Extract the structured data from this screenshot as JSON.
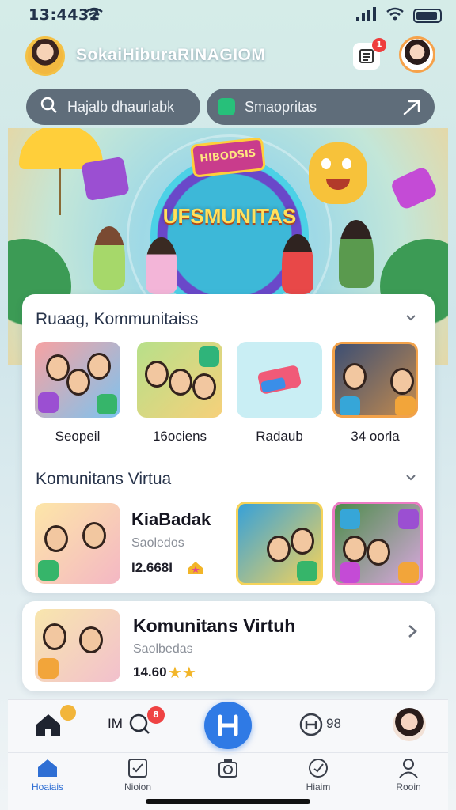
{
  "status_bar": {
    "time": "13:4432"
  },
  "header": {
    "app_title": "SokaiHiburaRINAGIOM",
    "notification_count": "1"
  },
  "search": {
    "left_placeholder": "Hajalb dhaurlabk",
    "right_placeholder": "Smaopritas"
  },
  "hero": {
    "title": "UFSMUNITAS",
    "sign": "HIBODSIS"
  },
  "sections": [
    {
      "title": "Ruaag, Kommunitaiss",
      "tiles": [
        {
          "label": "Seopeil"
        },
        {
          "label": "16ociens"
        },
        {
          "label": "Radaub"
        },
        {
          "label": "34 oorla"
        }
      ]
    },
    {
      "title": "Komunitans Virtua",
      "featured": {
        "name": "KiaBadak",
        "subtitle": "Saoledos",
        "stat": "I2.668I"
      }
    }
  ],
  "bottom_card": {
    "name": "Komunitans Virtuh",
    "subtitle": "Saolbedas",
    "stat": "14.60",
    "stars": "★★"
  },
  "dock": {
    "left_text": "IM",
    "right_text": "98",
    "mos_badge": "8"
  },
  "tabs": [
    {
      "label": "Hoaiais",
      "active": true
    },
    {
      "label": "Nioion",
      "active": false
    },
    {
      "label": "",
      "active": false
    },
    {
      "label": "Hiaim",
      "active": false
    },
    {
      "label": "Rooin",
      "active": false
    }
  ],
  "colors": {
    "accent": "#2f7ae5",
    "badge_red": "#ee3d3d",
    "star": "#f2b528"
  }
}
